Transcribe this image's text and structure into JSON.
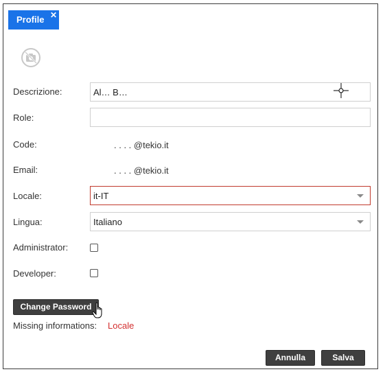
{
  "tab": {
    "label": "Profile",
    "close_glyph": "✕"
  },
  "avatar": {
    "icon": "camera-off-icon"
  },
  "form": {
    "descrizione": {
      "label": "Descrizione:",
      "value": "Al…      B…"
    },
    "role": {
      "label": "Role:",
      "value": ""
    },
    "code": {
      "label": "Code:",
      "value": ".   .   .   .      @tekio.it"
    },
    "email": {
      "label": "Email:",
      "value": ".   .   .   .      @tekio.it"
    },
    "locale": {
      "label": "Locale:",
      "value": "it-IT"
    },
    "lingua": {
      "label": "Lingua:",
      "value": "Italiano"
    },
    "administrator": {
      "label": "Administrator:",
      "checked": false
    },
    "developer": {
      "label": "Developer:",
      "checked": false
    }
  },
  "buttons": {
    "change_password": "Change Password",
    "annulla": "Annulla",
    "salva": "Salva"
  },
  "missing": {
    "label": "Missing informations:",
    "value": "Locale"
  },
  "colors": {
    "tab_bg": "#1a73e8",
    "error_border": "#c0392b",
    "error_text": "#d32f2f",
    "button_bg": "#3f3f3f"
  }
}
